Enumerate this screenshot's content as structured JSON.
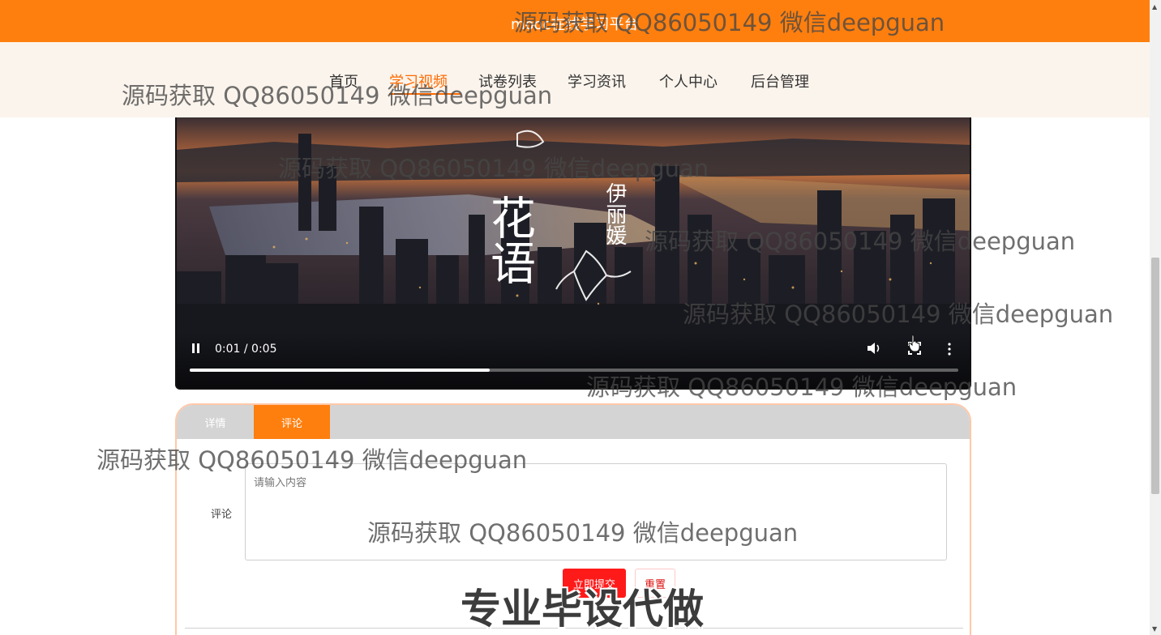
{
  "header": {
    "site_title": "mooc在线学习平台"
  },
  "nav": {
    "items": [
      {
        "label": "首页"
      },
      {
        "label": "学习视频",
        "active": true
      },
      {
        "label": "试卷列表"
      },
      {
        "label": "学习资讯"
      },
      {
        "label": "个人中心"
      },
      {
        "label": "后台管理"
      }
    ]
  },
  "video": {
    "overlay_title": "花语",
    "overlay_artist": "伊丽媛",
    "time_display": "0:01 / 0:05",
    "progress": 0.39,
    "icons": [
      "pause-icon",
      "volume-icon",
      "fullscreen-icon",
      "more-vert-icon"
    ]
  },
  "tabs": {
    "detail_label": "详情",
    "comment_label": "评论"
  },
  "comment_form": {
    "label": "评论",
    "placeholder": "请输入内容",
    "submit_label": "立即提交",
    "reset_label": "重置"
  },
  "watermarks": {
    "text": "源码获取 QQ86050149 微信deepguan",
    "big_text": "专业毕设代做"
  },
  "colors": {
    "brand_orange": "#ff7f0e",
    "nav_active": "#ff6a00",
    "submit_red": "#ff1a1a"
  }
}
